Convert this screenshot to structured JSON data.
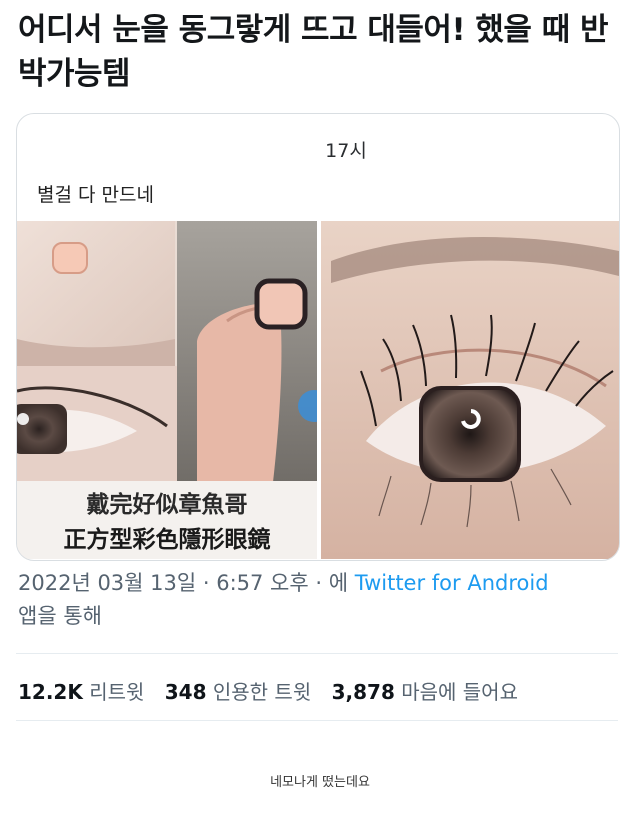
{
  "tweet": {
    "text": "어디서 눈을 동그랗게 뜨고 대들어! 했을 때 반박가능템"
  },
  "card": {
    "time": "17시",
    "caption": "별걸 다 만드네",
    "overlay_line1": "戴完好似章魚哥",
    "overlay_line2": "正方型彩色隱形眼鏡"
  },
  "meta": {
    "date": "2022년 03월 13일 · 6:57 오후 · 에 ",
    "source": "Twitter for Android",
    "suffix": "앱을 통해"
  },
  "stats": {
    "retweets_count": "12.2K",
    "retweets_label": "리트윗",
    "quotes_count": "348",
    "quotes_label": "인용한 트윗",
    "likes_count": "3,878",
    "likes_label": "마음에 들어요"
  },
  "bottom_caption": "네모나게 떴는데요",
  "colors": {
    "link": "#1d9bf0",
    "meta": "#566370",
    "border": "#d9dee2"
  }
}
